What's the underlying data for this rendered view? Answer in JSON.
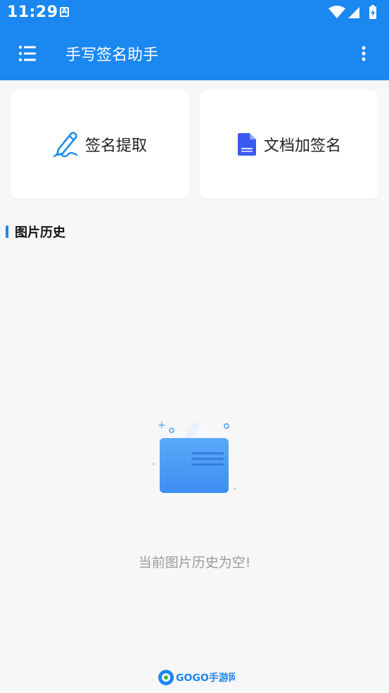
{
  "status_bar": {
    "time": "11:29",
    "notification_icon": "a-letter-icon",
    "icons": [
      "wifi-icon",
      "signal-icon",
      "battery-icon"
    ]
  },
  "app_bar": {
    "title": "手写签名助手",
    "menu_icon": "list-menu-icon",
    "more_icon": "more-vertical-icon"
  },
  "actions": [
    {
      "label": "签名提取",
      "icon": "pen-signature-icon"
    },
    {
      "label": "文档加签名",
      "icon": "document-file-icon"
    }
  ],
  "section": {
    "title": "图片历史"
  },
  "empty_state": {
    "message": "当前图片历史为空!",
    "icon": "empty-folder-icon"
  },
  "watermark": {
    "text": "GOGO手游网"
  },
  "colors": {
    "primary": "#1b87f0",
    "background": "#f7f7f7",
    "card": "#ffffff",
    "doc_icon": "#3b5bf0"
  }
}
